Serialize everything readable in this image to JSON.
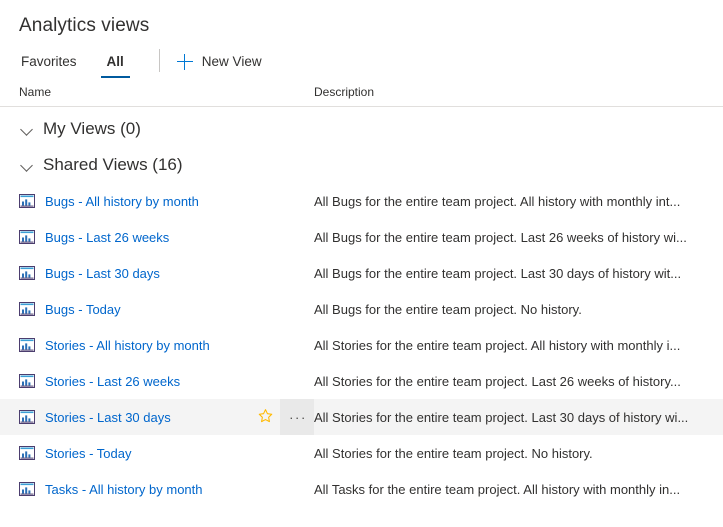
{
  "header": {
    "title": "Analytics views"
  },
  "tabs": [
    {
      "label": "Favorites",
      "active": false,
      "name": "tab-favorites"
    },
    {
      "label": "All",
      "active": true,
      "name": "tab-all"
    }
  ],
  "commands": {
    "new_view_label": "New View",
    "new_view_icon": "plus-icon"
  },
  "columns": {
    "name": "Name",
    "description": "Description"
  },
  "groups": [
    {
      "label": "My Views (0)",
      "expanded": true,
      "name": "group-my-views"
    },
    {
      "label": "Shared Views (16)",
      "expanded": true,
      "name": "group-shared-views"
    }
  ],
  "rows": [
    {
      "icon": "analytics-view-icon",
      "name": "Bugs - All history by month",
      "description": "All Bugs for the entire team project. All history with monthly int...",
      "hovered": false
    },
    {
      "icon": "analytics-view-icon",
      "name": "Bugs - Last 26 weeks",
      "description": "All Bugs for the entire team project. Last 26 weeks of history wi...",
      "hovered": false
    },
    {
      "icon": "analytics-view-icon",
      "name": "Bugs - Last 30 days",
      "description": "All Bugs for the entire team project. Last 30 days of history wit...",
      "hovered": false
    },
    {
      "icon": "analytics-view-icon",
      "name": "Bugs - Today",
      "description": "All Bugs for the entire team project. No history.",
      "hovered": false
    },
    {
      "icon": "analytics-view-icon",
      "name": "Stories - All history by month",
      "description": "All Stories for the entire team project. All history with monthly i...",
      "hovered": false
    },
    {
      "icon": "analytics-view-icon",
      "name": "Stories - Last 26 weeks",
      "description": "All Stories for the entire team project. Last 26 weeks of history...",
      "hovered": false
    },
    {
      "icon": "analytics-view-icon",
      "name": "Stories - Last 30 days",
      "description": "All Stories for the entire team project. Last 30 days of history wi...",
      "hovered": true,
      "favorite_icon": "star-outline-icon",
      "more_label": "···"
    },
    {
      "icon": "analytics-view-icon",
      "name": "Stories - Today",
      "description": "All Stories for the entire team project. No history.",
      "hovered": false
    },
    {
      "icon": "analytics-view-icon",
      "name": "Tasks - All history by month",
      "description": "All Tasks for the entire team project. All history with monthly in...",
      "hovered": false
    }
  ],
  "colors": {
    "link": "#0066cc",
    "accent": "#0078d4",
    "tab_underline": "#005a9e",
    "hover_row": "#f4f4f4",
    "more_button_bg": "#e9e9e9",
    "star": "#ffb900",
    "divider": "#e1dfdd",
    "text": "#323130"
  }
}
